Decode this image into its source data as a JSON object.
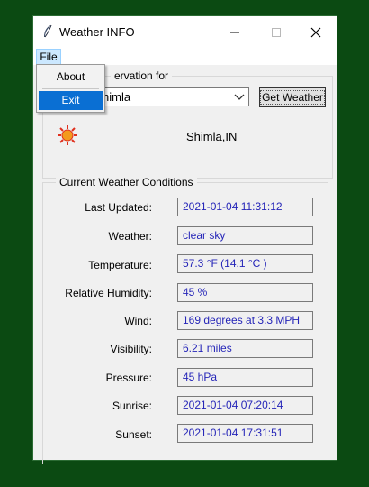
{
  "window": {
    "title": "Weather INFO"
  },
  "menubar": {
    "file": "File"
  },
  "file_menu": {
    "about": "About",
    "exit": "Exit"
  },
  "observation": {
    "group_title": "ervation for",
    "city_value": "himla",
    "get_button": "Get Weather",
    "location": "Shimla,IN"
  },
  "conditions": {
    "group_title": "Current Weather Conditions",
    "rows": [
      {
        "label": "Last Updated:",
        "value": "2021-01-04  11:31:12"
      },
      {
        "label": "Weather:",
        "value": "clear sky"
      },
      {
        "label": "Temperature:",
        "value": "57.3 °F  (14.1 °C )"
      },
      {
        "label": "Relative Humidity:",
        "value": "45 %"
      },
      {
        "label": "Wind:",
        "value": "169 degrees at 3.3 MPH"
      },
      {
        "label": "Visibility:",
        "value": "6.21 miles"
      },
      {
        "label": "Pressure:",
        "value": "45 hPa"
      },
      {
        "label": "Sunrise:",
        "value": "2021-01-04  07:20:14"
      },
      {
        "label": "Sunset:",
        "value": "2021-01-04  17:31:51"
      }
    ]
  },
  "colors": {
    "desktop": "#0b4a12",
    "value_text": "#2525b8",
    "menu_highlight": "#0a6fd3"
  }
}
